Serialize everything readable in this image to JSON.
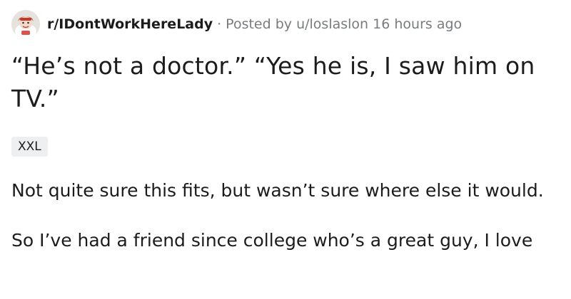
{
  "post": {
    "subreddit": "r/IDontWorkHereLady",
    "separator": "·",
    "posted_prefix": "Posted by",
    "author": "u/loslaslon",
    "age": "16 hours ago",
    "title": "“He’s not a doctor.” “Yes he is, I saw him on TV.”",
    "flair": "XXL",
    "paragraphs": [
      "Not quite sure this fits, but wasn’t sure where else it would.",
      "So I’ve had a friend since college who’s a great guy, I love"
    ]
  },
  "icons": {
    "subreddit_avatar": "subreddit-avatar-icon"
  }
}
